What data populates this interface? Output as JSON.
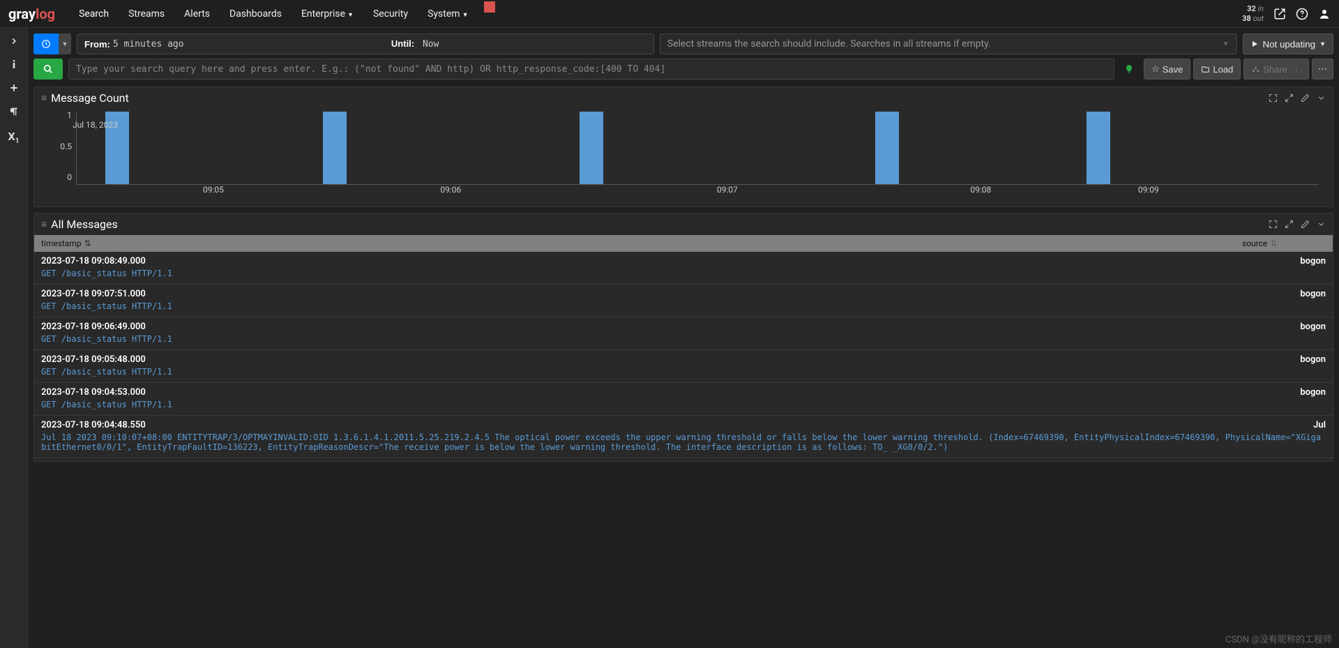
{
  "brand": {
    "part1": "gray",
    "part2": "log"
  },
  "nav": {
    "search": "Search",
    "streams": "Streams",
    "alerts": "Alerts",
    "dashboards": "Dashboards",
    "enterprise": "Enterprise",
    "security": "Security",
    "system": "System"
  },
  "io": {
    "in_num": "32",
    "in_lbl": "in",
    "out_num": "38",
    "out_lbl": "out"
  },
  "timerange": {
    "from_label": "From:",
    "from_value": "5 minutes ago",
    "until_label": "Until:",
    "until_value": "Now"
  },
  "streams_placeholder": "Select streams the search should include. Searches in all streams if empty.",
  "update_btn": "Not updating",
  "search_placeholder": "Type your search query here and press enter. E.g.: (\"not found\" AND http) OR http_response_code:[400 TO 404]",
  "actions": {
    "save": "Save",
    "load": "Load",
    "share": "Share"
  },
  "panel_chart": {
    "title": "Message Count"
  },
  "panel_table": {
    "title": "All Messages",
    "col_ts": "timestamp",
    "col_src": "source"
  },
  "chart_data": {
    "type": "bar",
    "title": "Message Count",
    "xlabel": "",
    "ylabel": "",
    "ylim": [
      0,
      1
    ],
    "yticks": [
      0,
      0.5,
      1
    ],
    "categories": [
      "09:05",
      "09:06",
      "09:07",
      "09:08",
      "09:09"
    ],
    "values": [
      1,
      1,
      1,
      1,
      1
    ],
    "x_date": "Jul 18, 2023",
    "bar_positions_pct": [
      2.3,
      19.8,
      40.5,
      64.3,
      81.3
    ]
  },
  "messages": [
    {
      "ts": "2023-07-18 09:08:49.000",
      "src": "bogon",
      "body": "GET /basic_status HTTP/1.1"
    },
    {
      "ts": "2023-07-18 09:07:51.000",
      "src": "bogon",
      "body": "GET /basic_status HTTP/1.1"
    },
    {
      "ts": "2023-07-18 09:06:49.000",
      "src": "bogon",
      "body": "GET /basic_status HTTP/1.1"
    },
    {
      "ts": "2023-07-18 09:05:48.000",
      "src": "bogon",
      "body": "GET /basic_status HTTP/1.1"
    },
    {
      "ts": "2023-07-18 09:04:53.000",
      "src": "bogon",
      "body": "GET /basic_status HTTP/1.1"
    },
    {
      "ts": "2023-07-18 09:04:48.550",
      "src": "Jul",
      "body": "Jul 18 2023 09:10:07+08:00        ENTITYTRAP/3/OPTMAYINVALID:OID 1.3.6.1.4.1.2011.5.25.219.2.4.5 The optical power exceeds the upper warning threshold or falls below the lower warning threshold. (Index=67469390, EntityPhysicalIndex=67469390, PhysicalName=\"XGigabitEthernet0/0/1\", EntityTrapFaultID=136223, EntityTrapReasonDescr=\"The receive power is below the lower warning threshold. The interface description is as follows: TO_       _XG0/0/2.\")"
    }
  ],
  "watermark": "CSDN @没有昵称的工程师"
}
